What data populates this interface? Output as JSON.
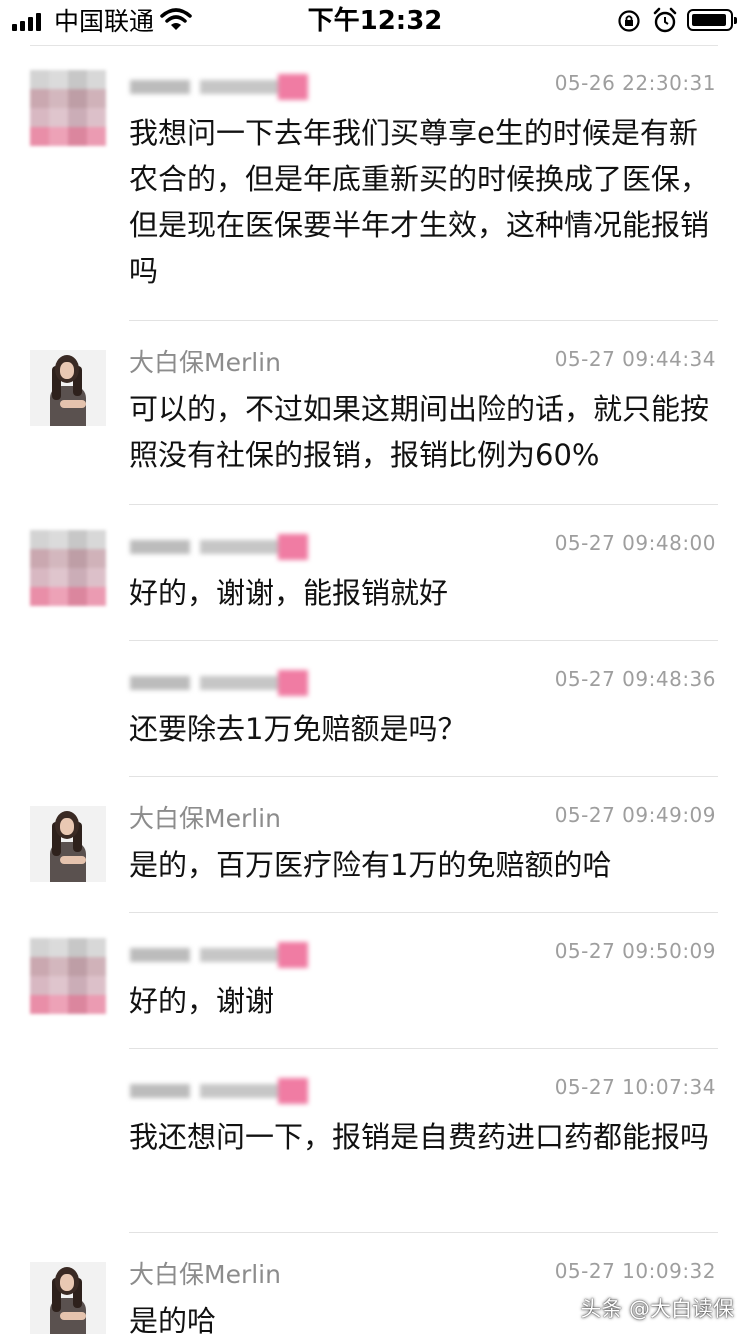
{
  "status_bar": {
    "carrier": "中国联通",
    "time": "下午12:32"
  },
  "messages": [
    {
      "sender": "",
      "timestamp": "05-26 22:30:31",
      "text": "我想问一下去年我们买尊享e生的时候是有新农合的，但是年底重新买的时候换成了医保，但是现在医保要半年才生效，这种情况能报销吗"
    },
    {
      "sender": "大白保Merlin",
      "timestamp": "05-27 09:44:34",
      "text": "可以的，不过如果这期间出险的话，就只能按照没有社保的报销，报销比例为60%"
    },
    {
      "sender": "",
      "timestamp": "05-27 09:48:00",
      "text": "好的，谢谢，能报销就好"
    },
    {
      "sender": "",
      "timestamp": "05-27 09:48:36",
      "text": "还要除去1万免赔额是吗？"
    },
    {
      "sender": "大白保Merlin",
      "timestamp": "05-27 09:49:09",
      "text": "是的，百万医疗险有1万的免赔额的哈"
    },
    {
      "sender": "",
      "timestamp": "05-27 09:50:09",
      "text": "好的，谢谢"
    },
    {
      "sender": "",
      "timestamp": "05-27 10:07:34",
      "text": "我还想问一下，报销是自费药进口药都能报吗"
    },
    {
      "sender": "大白保Merlin",
      "timestamp": "05-27 10:09:32",
      "text": "是的哈"
    }
  ],
  "watermark": "头条 @大白读保"
}
